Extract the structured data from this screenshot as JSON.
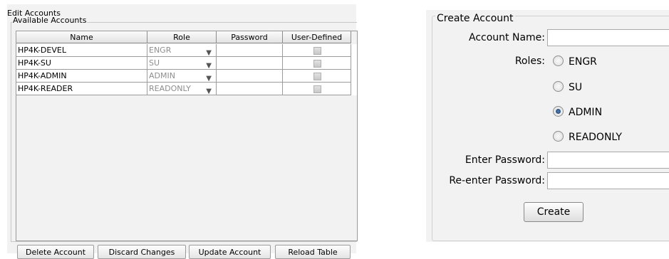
{
  "edit": {
    "title": "Edit Accounts",
    "legend": "Available Accounts",
    "columns": [
      "Name",
      "Role",
      "Password",
      "User-Defined"
    ],
    "rows": [
      {
        "name": "HP4K-DEVEL",
        "role": "ENGR"
      },
      {
        "name": "HP4K-SU",
        "role": "SU"
      },
      {
        "name": "HP4K-ADMIN",
        "role": "ADMIN"
      },
      {
        "name": "HP4K-READER",
        "role": "READONLY"
      }
    ],
    "buttons": {
      "delete": "Delete Account",
      "discard": "Discard Changes",
      "update": "Update Account",
      "reload": "Reload Table"
    }
  },
  "create": {
    "legend": "Create Account",
    "account_name_label": "Account Name:",
    "roles_label": "Roles:",
    "roles": [
      "ENGR",
      "SU",
      "ADMIN",
      "READONLY"
    ],
    "selected_role": "ADMIN",
    "password_label": "Enter Password:",
    "reenter_label": "Re-enter Password:",
    "button": "Create"
  }
}
